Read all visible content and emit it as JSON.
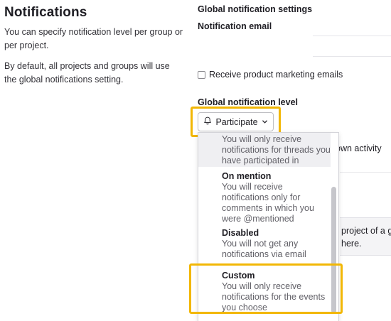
{
  "left": {
    "title": "Notifications",
    "para1": "You can specify notification level per group or per project.",
    "para2": "By default, all projects and groups will use the global notifications setting."
  },
  "right": {
    "heading": "Global notification settings",
    "email_label": "Notification email",
    "email_value": "",
    "marketing_label": "Receive product marketing emails",
    "marketing_checked": false,
    "level_label": "Global notification level",
    "level_button": "Participate"
  },
  "dropdown": {
    "selected_desc": "You will only receive notifications for threads you have participated in",
    "items": [
      {
        "title": "On mention",
        "desc": "You will receive notifications only for comments in which you were @mentioned"
      },
      {
        "title": "Disabled",
        "desc": "You will not get any notifications via email"
      },
      {
        "title": "Custom",
        "desc": "You will only receive notifications for the events you choose"
      }
    ]
  },
  "background": {
    "own_activity": "own activity",
    "project_text": "project of a g",
    "here_text": "here."
  },
  "colors": {
    "highlight": "#f2b705",
    "selected_bg": "#efeff2"
  }
}
